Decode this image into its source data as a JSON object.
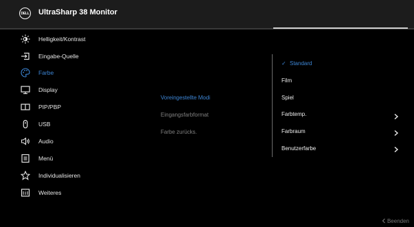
{
  "header": {
    "logo_text": "DELL",
    "title": "UltraSharp 38 Monitor"
  },
  "colors": {
    "accent": "#3d86d6",
    "text": "#e6e6e6",
    "muted": "#808080",
    "bg": "#000000",
    "titlebar": "#1c1c1c"
  },
  "main_menu": [
    {
      "label": "Helligkeit/Kontrast",
      "icon": "brightness-icon"
    },
    {
      "label": "Eingabe-Quelle",
      "icon": "input-source-icon"
    },
    {
      "label": "Farbe",
      "icon": "color-palette-icon",
      "active": true
    },
    {
      "label": "Display",
      "icon": "display-icon"
    },
    {
      "label": "PIP/PBP",
      "icon": "pip-pbp-icon"
    },
    {
      "label": "USB",
      "icon": "usb-icon"
    },
    {
      "label": "Audio",
      "icon": "audio-icon"
    },
    {
      "label": "Menü",
      "icon": "menu-icon"
    },
    {
      "label": "Individualisieren",
      "icon": "star-icon"
    },
    {
      "label": "Weiteres",
      "icon": "others-icon"
    }
  ],
  "sub_menu": [
    {
      "label": "Voreingestellte Modi",
      "active": true
    },
    {
      "label": "Eingangsfarbformat"
    },
    {
      "label": "Farbe zurücks."
    }
  ],
  "options": [
    {
      "label": "Standard",
      "selected": true,
      "check": "✓"
    },
    {
      "label": "Film"
    },
    {
      "label": "Spiel"
    },
    {
      "label": "Farbtemp.",
      "submenu": true
    },
    {
      "label": "Farbraum",
      "submenu": true
    },
    {
      "label": "Benutzerfarbe",
      "submenu": true
    }
  ],
  "footer": {
    "exit_label": "Beenden",
    "exit_icon": "chevron-left-icon"
  }
}
